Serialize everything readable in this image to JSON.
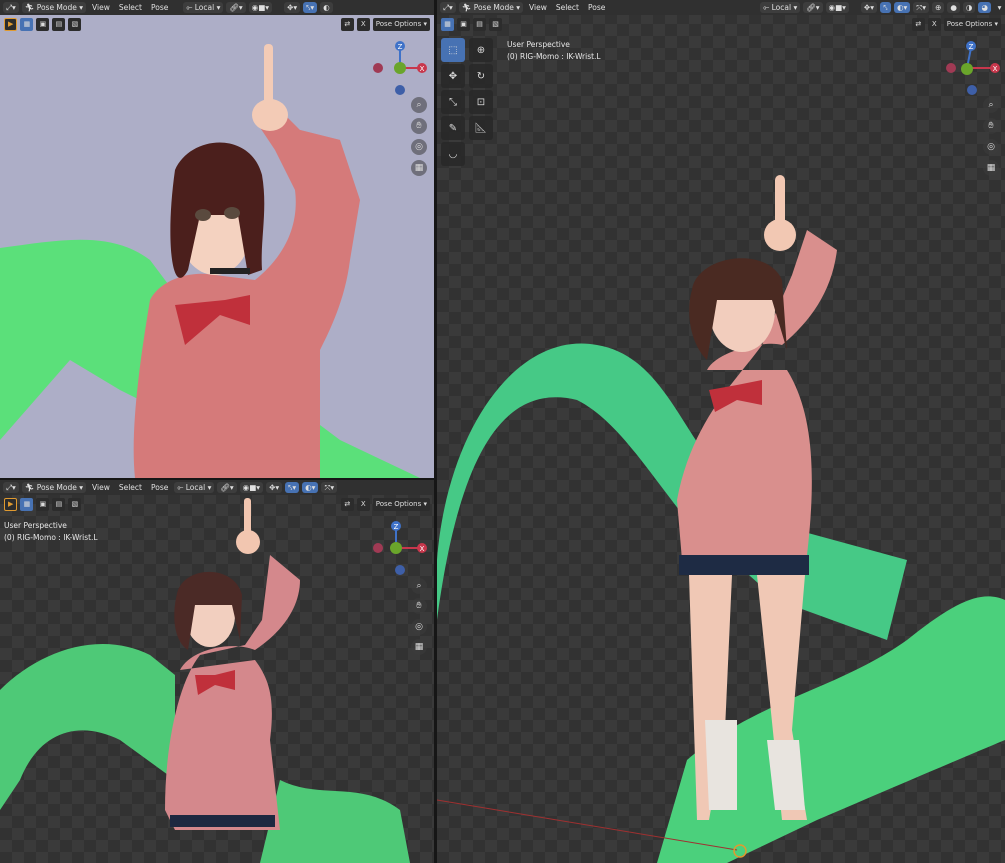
{
  "header": {
    "mode_label": "Pose Mode",
    "menu_view": "View",
    "menu_select": "Select",
    "menu_pose": "Pose",
    "transform_orientation": "Local"
  },
  "toolbar": {
    "x_label": "X",
    "pose_options_label": "Pose Options"
  },
  "viewport_overlay": {
    "perspective_label": "User Perspective",
    "object_info": "(0) RIG-Momo : IK-Wrist.L"
  },
  "gizmo": {
    "axis_z": "Z",
    "axis_x": "X"
  },
  "colors": {
    "header_bg": "#303030",
    "active_blue": "#4772b3",
    "axis_x": "#c8374c",
    "axis_y": "#6aa52b",
    "axis_z": "#3f72c8",
    "solid_bg": "#adaec7",
    "ribbon_green": "#5be07a"
  },
  "icons": [
    "editor-type-icon",
    "pose-mode-icon",
    "pivot-icon",
    "snap-icon",
    "proportional-icon",
    "overlay-icon",
    "gizmo-icon",
    "zoom-icon",
    "hand-icon",
    "camera-icon",
    "grid-icon",
    "cursor-tool-icon",
    "move-icon",
    "rotate-icon",
    "scale-icon",
    "transform-icon",
    "annotate-icon",
    "measure-icon",
    "relax-icon"
  ]
}
